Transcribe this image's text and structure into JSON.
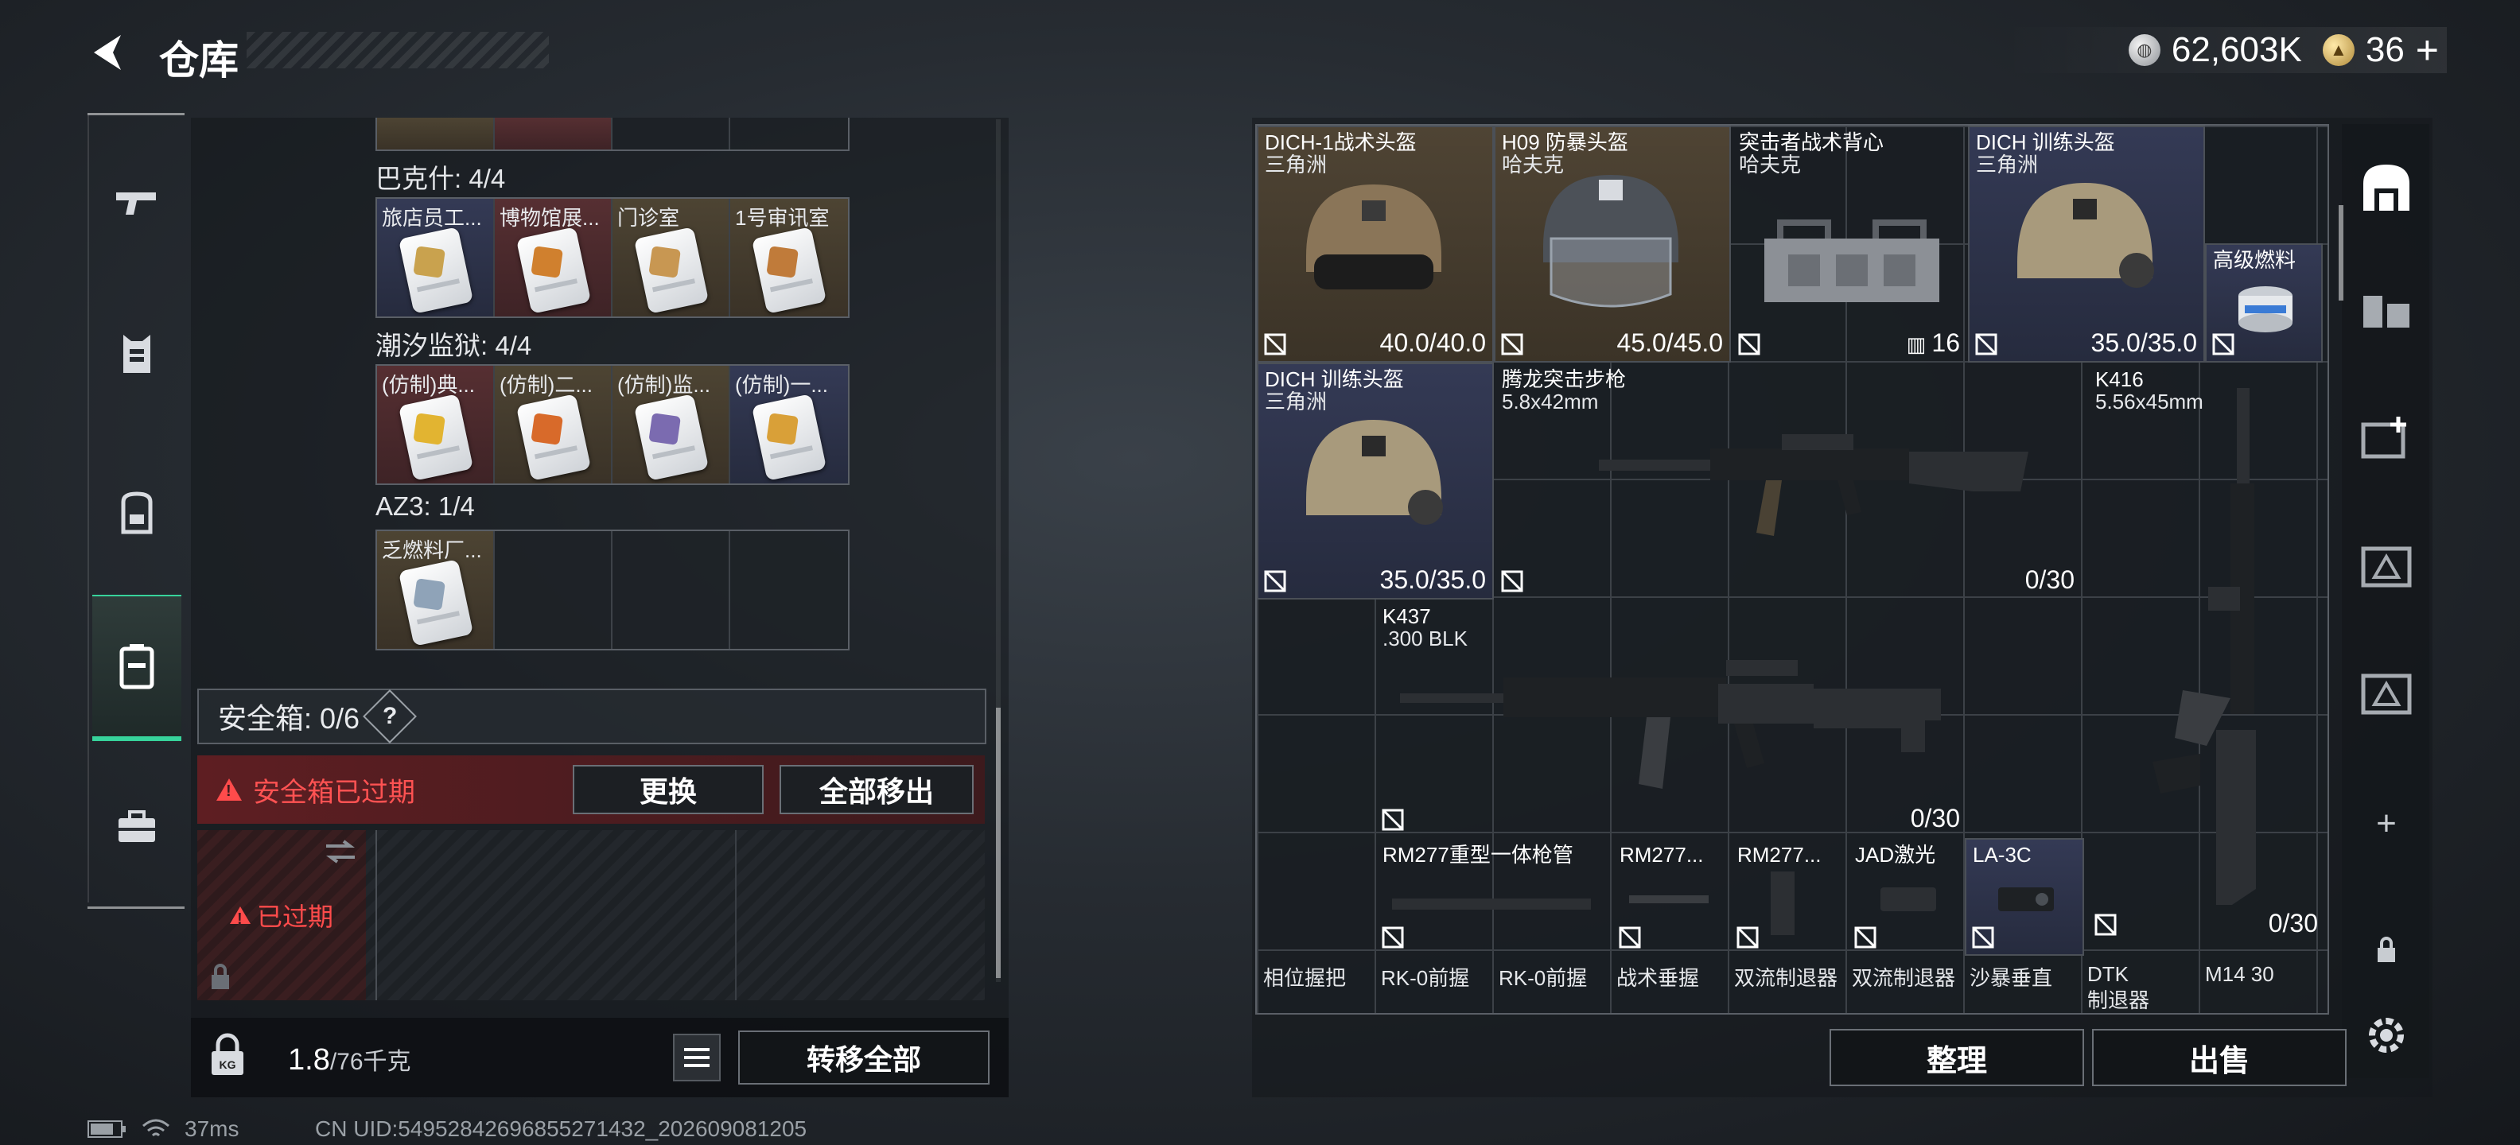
{
  "header": {
    "title": "仓库",
    "currency": {
      "silver": "62,603K",
      "gold": "36",
      "plus": "+"
    }
  },
  "left_nav": [
    "gun-icon",
    "vest-icon",
    "backpack-icon",
    "safebox-icon",
    "briefcase-icon"
  ],
  "containers": [
    {
      "label": "巴克什: 4/4",
      "items": [
        "旅店员工...",
        "博物馆展...",
        "门诊室",
        "1号审讯室"
      ]
    },
    {
      "label": "潮汐监狱: 4/4",
      "items": [
        "(仿制)典...",
        "(仿制)二...",
        "(仿制)监...",
        "(仿制)一..."
      ]
    },
    {
      "label": "AZ3: 1/4",
      "items": [
        "乏燃料厂..."
      ]
    }
  ],
  "safebox": {
    "label": "安全箱: 0/6",
    "help": "?",
    "warning": "安全箱已过期",
    "replace": "更换",
    "move_all_out": "全部移出",
    "expired": "已过期"
  },
  "bottom_left": {
    "weight": "1.8",
    "weight_max": "/76千克",
    "transfer_all": "转移全部"
  },
  "stash": {
    "helmet1": {
      "name": "DICH-1战术头盔",
      "origin": "三角洲",
      "dur": "40.0/40.0"
    },
    "helmet2": {
      "name": "H09 防暴头盔",
      "origin": "哈夫克",
      "dur": "45.0/45.0"
    },
    "vest": {
      "name": "突击者战术背心",
      "origin": "哈夫克",
      "count": "16"
    },
    "helmet3": {
      "name": "DICH 训练头盔",
      "origin": "三角洲",
      "dur": "35.0/35.0"
    },
    "fuel": {
      "name": "高级燃料"
    },
    "helmet4": {
      "name": "DICH 训练头盔",
      "origin": "三角洲",
      "dur": "35.0/35.0"
    },
    "rifle1": {
      "name": "腾龙突击步枪",
      "caliber": "5.8x42mm",
      "ammo": "0/30"
    },
    "rifle2": {
      "name": "K416",
      "caliber": "5.56x45mm",
      "ammo": "0/30"
    },
    "rifle3": {
      "name": "K437",
      "caliber": ".300 BLK",
      "ammo": "0/30"
    },
    "parts": [
      "RM277重型一体枪管",
      "RM277...",
      "RM277...",
      "JAD激光",
      "LA-3C"
    ],
    "row_bottom": [
      "相位握把",
      "RK-0前握",
      "RK-0前握",
      "战术垂握",
      "双流制退器",
      "双流制退器",
      "沙暴垂直",
      "DTK",
      "M14 30"
    ],
    "dtk_sub": "制退器"
  },
  "actions": {
    "sort": "整理",
    "sell": "出售"
  },
  "status": {
    "ping": "37ms",
    "uid": "CN UID:5495284269685527143​2_202609081205"
  }
}
